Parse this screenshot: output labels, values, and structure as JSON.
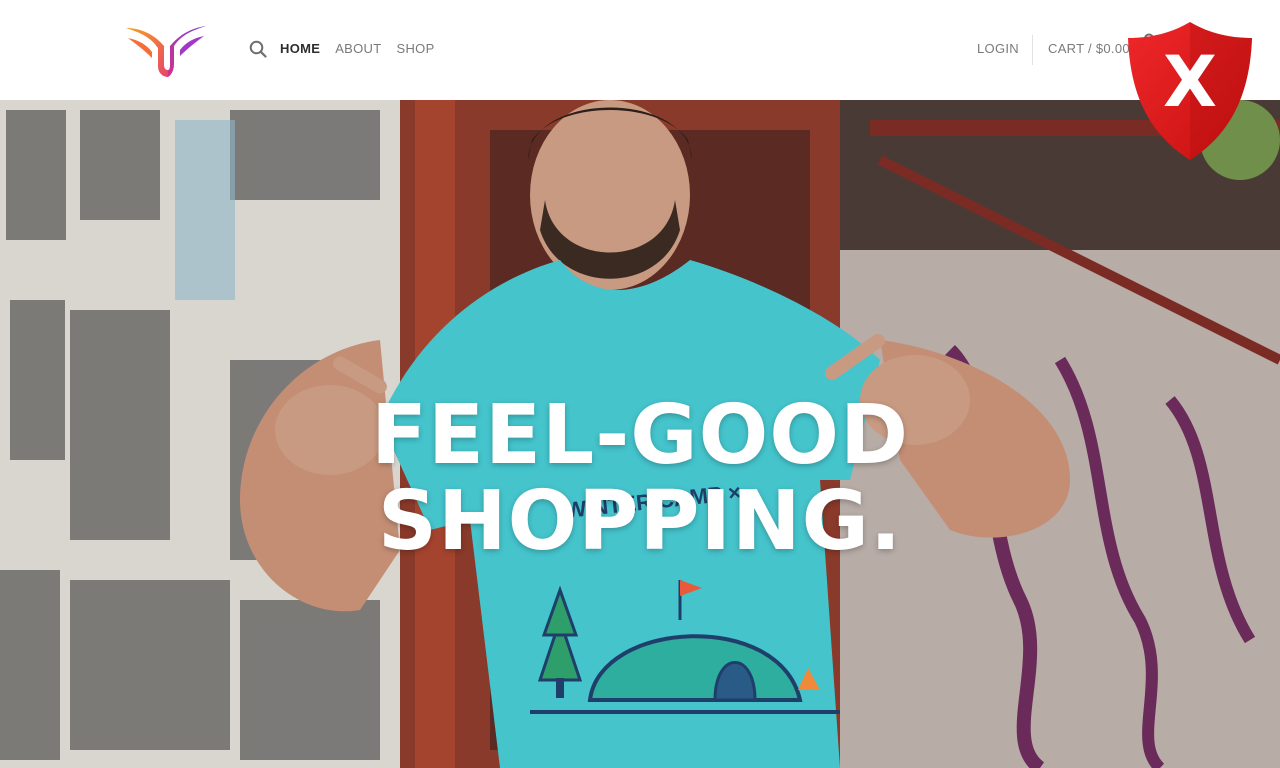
{
  "header": {
    "logo_icon": "winged-u-logo-icon",
    "search_icon": "search-icon",
    "nav": [
      {
        "label": "HOME",
        "active": true
      },
      {
        "label": "ABOUT",
        "active": false
      },
      {
        "label": "SHOP",
        "active": false
      }
    ],
    "login_label": "LOGIN",
    "cart_label": "CART / $0.00",
    "cart_icon": "shopping-bag-icon"
  },
  "hero": {
    "title_line1": "FEEL-GOOD",
    "title_line2": "SHOPPING.",
    "shirt_text": "WINTER CAMP"
  },
  "overlay": {
    "shield_icon": "red-shield-x-icon",
    "shield_mark": "X"
  },
  "colors": {
    "accent_active": "#2e2e2e",
    "nav_muted": "#7a7a7a",
    "shirt": "#45c4cc",
    "shield_red": "#e0191b"
  }
}
